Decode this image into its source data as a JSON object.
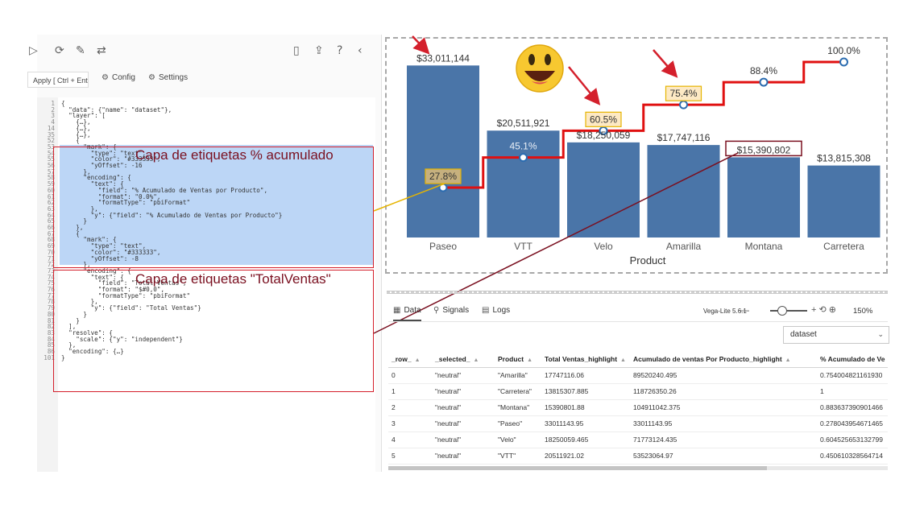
{
  "toolbar": {
    "apply_label": "Apply [ Ctrl + Enter ]",
    "config_label": "Config",
    "settings_label": "Settings"
  },
  "code_lines": [
    {
      "n": "1",
      "text": "{"
    },
    {
      "n": "2",
      "text": "  \"data\": {\"name\": \"dataset\"},"
    },
    {
      "n": "3",
      "text": "  \"layer\": ["
    },
    {
      "n": "4",
      "text": "    {…},"
    },
    {
      "n": "14",
      "text": "    {…},"
    },
    {
      "n": "35",
      "text": "    {…},"
    },
    {
      "n": "52",
      "text": "    {"
    },
    {
      "n": "53",
      "text": "      \"mark\": {"
    },
    {
      "n": "54",
      "text": "        \"type\": \"text\","
    },
    {
      "n": "55",
      "text": "        \"color\": \"#333333\","
    },
    {
      "n": "56",
      "text": "        \"yOffset\": -16"
    },
    {
      "n": "57",
      "text": "      },"
    },
    {
      "n": "58",
      "text": "      \"encoding\": {"
    },
    {
      "n": "59",
      "text": "        \"text\": {"
    },
    {
      "n": "60",
      "text": "          \"field\": \"% Acumulado de Ventas por Producto\","
    },
    {
      "n": "61",
      "text": "          \"format\": \"0.0%\","
    },
    {
      "n": "62",
      "text": "          \"formatType\": \"pbiFormat\""
    },
    {
      "n": "63",
      "text": "        },"
    },
    {
      "n": "64",
      "text": "        \"y\": {\"field\": \"% Acumulado de Ventas por Producto\"}"
    },
    {
      "n": "65",
      "text": "      }"
    },
    {
      "n": "66",
      "text": "    },"
    },
    {
      "n": "67",
      "text": "    {"
    },
    {
      "n": "68",
      "text": "      \"mark\": {"
    },
    {
      "n": "69",
      "text": "        \"type\": \"text\","
    },
    {
      "n": "70",
      "text": "        \"color\": \"#333333\","
    },
    {
      "n": "71",
      "text": "        \"yOffset\": -8"
    },
    {
      "n": "72",
      "text": "      },"
    },
    {
      "n": "73",
      "text": "      \"encoding\": {"
    },
    {
      "n": "74",
      "text": "        \"text\": {"
    },
    {
      "n": "75",
      "text": "          \"field\": \"Total Ventas\","
    },
    {
      "n": "76",
      "text": "          \"format\": \"$#0,0\","
    },
    {
      "n": "77",
      "text": "          \"formatType\": \"pbiFormat\""
    },
    {
      "n": "78",
      "text": "        },"
    },
    {
      "n": "79",
      "text": "        \"y\": {\"field\": \"Total Ventas\"}"
    },
    {
      "n": "80",
      "text": "      }"
    },
    {
      "n": "81",
      "text": "    }"
    },
    {
      "n": "82",
      "text": "  ],"
    },
    {
      "n": "83",
      "text": "  \"resolve\": {"
    },
    {
      "n": "84",
      "text": "    \"scale\": {\"y\": \"independent\"}"
    },
    {
      "n": "85",
      "text": "  },"
    },
    {
      "n": "86",
      "text": "  \"encoding\": {…}"
    },
    {
      "n": "101",
      "text": "}"
    }
  ],
  "annotations": {
    "cumulative_label": "Capa de etiquetas % acumulado",
    "total_label": "Capa de etiquetas \"TotalVentas\"",
    "highlight_color": "#bcd6f6",
    "box_color": "#d4202c"
  },
  "chart_data": {
    "type": "bar",
    "categories": [
      "Paseo",
      "VTT",
      "Velo",
      "Amarilla",
      "Montana",
      "Carretera"
    ],
    "series": [
      {
        "values": [
          33011144,
          20511921,
          18250059,
          17747116,
          15390802,
          13815308
        ]
      },
      {
        "values": [
          0.278,
          0.451,
          0.605,
          0.754,
          0.884,
          1.0
        ]
      }
    ],
    "bar_labels": [
      "$33,011,144",
      "$20,511,921",
      "$18,250,059",
      "$17,747,116",
      "$15,390,802",
      "$13,815,308"
    ],
    "pct_labels": [
      "27.8%",
      "45.1%",
      "60.5%",
      "75.4%",
      "88.4%",
      "100.0%"
    ],
    "xlabel": "Product",
    "ylabel": "",
    "ylim": [
      0,
      36000000
    ],
    "bar_color": "#4a75a8",
    "line_color": "#e01010",
    "highlight_box_color": "#fde9c4"
  },
  "data_panel": {
    "tabs": [
      "Data",
      "Signals",
      "Logs"
    ],
    "vega_version": "Vega-Lite 5.6.1",
    "zoom_level": "150%",
    "dataset": "dataset",
    "columns": [
      "_row_",
      "_selected_",
      "Product",
      "Total Ventas_highlight",
      "Acumulado de ventas Por Producto_highlight",
      "% Acumulado de Ve"
    ],
    "rows": [
      [
        "0",
        "\"neutral\"",
        "\"Amarilla\"",
        "17747116.06",
        "89520240.495",
        "0.754004821161930"
      ],
      [
        "1",
        "\"neutral\"",
        "\"Carretera\"",
        "13815307.885",
        "118726350.26",
        "1"
      ],
      [
        "2",
        "\"neutral\"",
        "\"Montana\"",
        "15390801.88",
        "104911042.375",
        "0.883637390901466"
      ],
      [
        "3",
        "\"neutral\"",
        "\"Paseo\"",
        "33011143.95",
        "33011143.95",
        "0.278043954671465"
      ],
      [
        "4",
        "\"neutral\"",
        "\"Velo\"",
        "18250059.465",
        "71773124.435",
        "0.604525653132799"
      ],
      [
        "5",
        "\"neutral\"",
        "\"VTT\"",
        "20511921.02",
        "53523064.97",
        "0.450610328564714"
      ]
    ]
  }
}
